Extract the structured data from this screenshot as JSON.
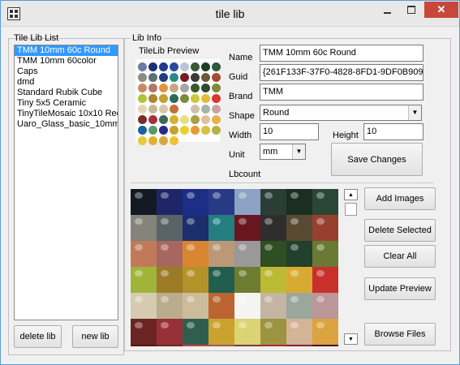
{
  "window": {
    "title": "tile lib"
  },
  "tile_lib_list": {
    "caption": "Tile Lib List",
    "items": [
      "TMM 10mm 60c Round",
      "TMM 10mm 60color",
      "Caps",
      "dmd",
      "Standard Rubik Cube",
      "Tiny 5x5 Ceramic",
      "TinyTileMosaic 10x10 Rec",
      "Uaro_Glass_basic_10mm_"
    ],
    "selected_index": 0,
    "delete_label": "delete lib",
    "new_label": "new lib"
  },
  "lib_info": {
    "caption": "Lib Info",
    "preview_label": "TileLib Preview",
    "name_label": "Name",
    "name_value": "TMM 10mm 60c Round",
    "guid_label": "Guid",
    "guid_value": "{261F133F-37F0-4828-8FD1-9DF0B9098",
    "brand_label": "Brand",
    "brand_value": "TMM",
    "shape_label": "Shape",
    "shape_value": "Round",
    "width_label": "Width",
    "width_value": "10",
    "height_label": "Height",
    "height_value": "10",
    "unit_label": "Unit",
    "unit_value": "mm",
    "save_label": "Save Changes",
    "lbcount_label": "Lbcount"
  },
  "actions": {
    "add_images": "Add Images",
    "delete_selected": "Delete Selected",
    "clear_all": "Clear All",
    "update_preview": "Update Preview",
    "browse_files": "Browse Files"
  },
  "preview_colors": [
    "#6e7aa0",
    "#1c2f78",
    "#1f3a8a",
    "#2a4aa0",
    "#b8c4d8",
    "#345a3a",
    "#1d3f2a",
    "#2e5a3e",
    "#8c8c86",
    "#5e6e74",
    "#263c7c",
    "#2c8a8c",
    "#7d1a24",
    "#3a3a3a",
    "#6b5a3a",
    "#a84a38",
    "#c88a64",
    "#b4766a",
    "#e3953a",
    "#c8a684",
    "#a6a4a4",
    "#3a5a2a",
    "#2d4a34",
    "#7c8c3c",
    "#b0c43a",
    "#aa8830",
    "#c2a030",
    "#2a6a58",
    "#7c8a3a",
    "#c9c83a",
    "#e8b83a",
    "#d83830",
    "#e2d6b8",
    "#c8b89a",
    "#d8c8a8",
    "#c86e3a",
    "#ffffff",
    "#d0c0b0",
    "#a6b4a8",
    "#caa2a4",
    "#7a2a2a",
    "#a8323a",
    "#3a6a58",
    "#d8b034",
    "#e8e080",
    "#a8a048",
    "#e0c0a0",
    "#e8b048",
    "#1c5fa0",
    "#5a9a6a",
    "#2a2a8a",
    "#c8a030",
    "#e8d030",
    "#e89a30",
    "#d8c040",
    "#b8b040",
    "#e8c840",
    "#e0b030",
    "#d8a840",
    "#f0c030"
  ],
  "tile_colors": [
    "#141a24",
    "#1e2668",
    "#1c2e86",
    "#283a86",
    "#8ca2c4",
    "#2a3e36",
    "#1a2e22",
    "#2a4636",
    "#84847a",
    "#5a6468",
    "#1c2e6e",
    "#247e80",
    "#6a1620",
    "#2e2e2e",
    "#584a32",
    "#984030",
    "#c07a5a",
    "#a86660",
    "#d88632",
    "#bc9878",
    "#9a9898",
    "#304e24",
    "#22402c",
    "#6a7a34",
    "#a0b43a",
    "#9c7a28",
    "#b4922a",
    "#225e4e",
    "#6e7c32",
    "#bcba34",
    "#d8aa32",
    "#c8302a",
    "#d6cab0",
    "#bcac8e",
    "#ccbc9c",
    "#bc6432",
    "#f4f4f2",
    "#c4b4a4",
    "#9aa89c",
    "#bc9698",
    "#6a2424",
    "#983038",
    "#305e4e",
    "#cca22e",
    "#dcd474",
    "#9c9440",
    "#d4b496",
    "#dca440",
    "#5a1018",
    "#6a2a1a",
    "#c04838",
    "#a05a52",
    "#7a3a3a",
    "#b02838",
    "#8a2030",
    "#4a1418"
  ]
}
